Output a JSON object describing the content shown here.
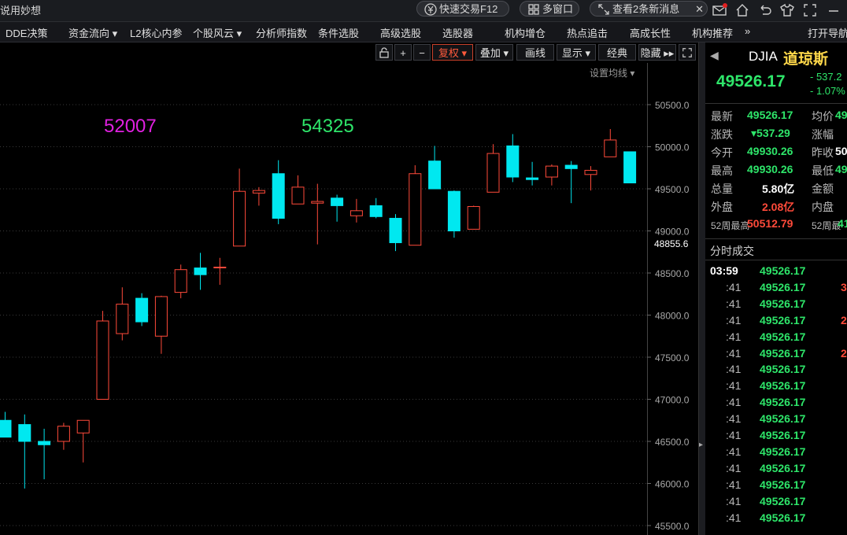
{
  "titlebar": {
    "app_title": "说用妙想",
    "quick_trade": "快速交易F12",
    "multi_window": "多窗口",
    "new_messages": "查看2条新消息"
  },
  "menu": [
    "DDE决策",
    "资金流向 ▾",
    "L2核心内参",
    "个股风云 ▾",
    "分析师指数",
    "条件选股",
    "高级选股",
    "选股器",
    "机构增仓",
    "热点追击",
    "高成长性",
    "机构推荐",
    "»",
    "打开导航"
  ],
  "chart_toolbar": {
    "restore": "复权 ▾",
    "overlay": "叠加 ▾",
    "draw": "画线",
    "display": "显示 ▾",
    "classic": "经典",
    "hide": "隐藏 ▸▸",
    "ma_settings": "设置均线 ▾"
  },
  "chart_data": {
    "type": "candlestick",
    "price_axis_ticks": [
      "50500.0",
      "50000.0",
      "49500.0",
      "49000.0",
      "48500.0",
      "48000.0",
      "47500.0",
      "47000.0",
      "46500.0",
      "46000.0",
      "45500.0"
    ],
    "current_price_label": "48855.6",
    "annotations": [
      {
        "text": "52007",
        "color": "#e020e0"
      },
      {
        "text": "54325",
        "color": "#2ee66a"
      }
    ],
    "ylim": [
      45500,
      50700
    ],
    "candles": [
      {
        "o": 46750,
        "h": 46850,
        "l": 46550,
        "c": 46550
      },
      {
        "o": 46700,
        "h": 46820,
        "l": 45940,
        "c": 46500
      },
      {
        "o": 46500,
        "h": 46650,
        "l": 46050,
        "c": 46460
      },
      {
        "o": 46500,
        "h": 46720,
        "l": 46400,
        "c": 46680
      },
      {
        "o": 46600,
        "h": 46650,
        "l": 46250,
        "c": 46750
      },
      {
        "o": 47000,
        "h": 48050,
        "l": 47000,
        "c": 47930
      },
      {
        "o": 47780,
        "h": 48330,
        "l": 47700,
        "c": 48130
      },
      {
        "o": 48200,
        "h": 48260,
        "l": 47870,
        "c": 47920
      },
      {
        "o": 47750,
        "h": 48230,
        "l": 47540,
        "c": 48220
      },
      {
        "o": 48270,
        "h": 48600,
        "l": 48200,
        "c": 48540
      },
      {
        "o": 48560,
        "h": 48740,
        "l": 48300,
        "c": 48480
      },
      {
        "o": 48570,
        "h": 48680,
        "l": 48360,
        "c": 48570
      },
      {
        "o": 48820,
        "h": 49740,
        "l": 48820,
        "c": 49470
      },
      {
        "o": 49450,
        "h": 49520,
        "l": 49300,
        "c": 49480
      },
      {
        "o": 49680,
        "h": 49840,
        "l": 49080,
        "c": 49150
      },
      {
        "o": 49320,
        "h": 49660,
        "l": 49320,
        "c": 49520
      },
      {
        "o": 49330,
        "h": 49560,
        "l": 48840,
        "c": 49350
      },
      {
        "o": 49390,
        "h": 49430,
        "l": 49110,
        "c": 49300
      },
      {
        "o": 49180,
        "h": 49380,
        "l": 49100,
        "c": 49240
      },
      {
        "o": 49300,
        "h": 49390,
        "l": 49150,
        "c": 49170
      },
      {
        "o": 49150,
        "h": 49200,
        "l": 48760,
        "c": 48860
      },
      {
        "o": 48830,
        "h": 49780,
        "l": 48830,
        "c": 49680
      },
      {
        "o": 49830,
        "h": 50010,
        "l": 49520,
        "c": 49500
      },
      {
        "o": 49470,
        "h": 49480,
        "l": 48920,
        "c": 49000
      },
      {
        "o": 49020,
        "h": 49300,
        "l": 49020,
        "c": 49290
      },
      {
        "o": 49460,
        "h": 50030,
        "l": 49460,
        "c": 49920
      },
      {
        "o": 50010,
        "h": 50150,
        "l": 49580,
        "c": 49640
      },
      {
        "o": 49630,
        "h": 49820,
        "l": 49540,
        "c": 49610
      },
      {
        "o": 49640,
        "h": 49790,
        "l": 49540,
        "c": 49770
      },
      {
        "o": 49780,
        "h": 49830,
        "l": 49330,
        "c": 49740
      },
      {
        "o": 49670,
        "h": 49770,
        "l": 49480,
        "c": 49720
      },
      {
        "o": 49880,
        "h": 50210,
        "l": 49880,
        "c": 50080
      },
      {
        "o": 49940,
        "h": 49940,
        "l": 49570,
        "c": 49570
      }
    ]
  },
  "quote": {
    "code": "DJIA",
    "name": "道琼斯",
    "price": "49526.17",
    "change": "- 537.2",
    "change_pct": "- 1.07%",
    "rows": [
      {
        "l1": "最新",
        "v1": "49526.17",
        "l2": "均价",
        "v2": "49"
      },
      {
        "l1": "涨跌",
        "v1": "▾537.29",
        "l2": "涨幅",
        "v2": ""
      },
      {
        "l1": "今开",
        "v1": "49930.26",
        "l2": "昨收",
        "v2": "50"
      },
      {
        "l1": "最高",
        "v1": "49930.26",
        "l2": "最低",
        "v2": "49"
      },
      {
        "l1": "总量",
        "v1": "5.80亿",
        "l2": "金额",
        "v2": ""
      },
      {
        "l1": "外盘",
        "v1": "2.08亿",
        "l2": "内盘",
        "v2": ""
      },
      {
        "l1": "52周最高",
        "v1": "50512.79",
        "l2": "52周最",
        "v2": "41"
      }
    ]
  },
  "ticks": {
    "title": "分时成交",
    "rows": [
      {
        "t": "03:59",
        "p": "49526.17",
        "v": ""
      },
      {
        "t": ":41",
        "p": "49526.17",
        "v": "3"
      },
      {
        "t": ":41",
        "p": "49526.17",
        "v": ""
      },
      {
        "t": ":41",
        "p": "49526.17",
        "v": "2"
      },
      {
        "t": ":41",
        "p": "49526.17",
        "v": ""
      },
      {
        "t": ":41",
        "p": "49526.17",
        "v": "2"
      },
      {
        "t": ":41",
        "p": "49526.17",
        "v": ""
      },
      {
        "t": ":41",
        "p": "49526.17",
        "v": ""
      },
      {
        "t": ":41",
        "p": "49526.17",
        "v": ""
      },
      {
        "t": ":41",
        "p": "49526.17",
        "v": ""
      },
      {
        "t": ":41",
        "p": "49526.17",
        "v": ""
      },
      {
        "t": ":41",
        "p": "49526.17",
        "v": ""
      },
      {
        "t": ":41",
        "p": "49526.17",
        "v": ""
      },
      {
        "t": ":41",
        "p": "49526.17",
        "v": ""
      },
      {
        "t": ":41",
        "p": "49526.17",
        "v": ""
      },
      {
        "t": ":41",
        "p": "49526.17",
        "v": ""
      }
    ]
  }
}
